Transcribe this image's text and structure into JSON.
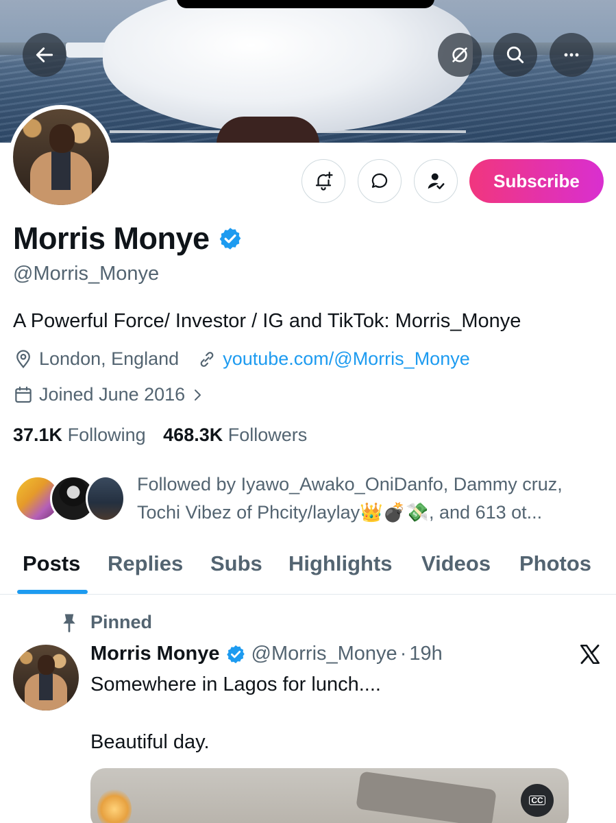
{
  "profile": {
    "name": "Morris Monye",
    "handle": "@Morris_Monye",
    "bio": "A Powerful Force/ Investor / IG and TikTok: Morris_Monye",
    "location": "London, England",
    "website": "youtube.com/@Morris_Monye",
    "joined": "Joined June 2016",
    "verified_color": "#1d9bf0"
  },
  "actions": {
    "subscribe_label": "Subscribe",
    "subscribe_gradient": [
      "#f1367e",
      "#d92fd0"
    ]
  },
  "header_icons": [
    "back-arrow-icon",
    "grok-icon",
    "search-icon",
    "more-icon"
  ],
  "stats": {
    "following_count": "37.1K",
    "following_label": "Following",
    "followers_count": "468.3K",
    "followers_label": "Followers"
  },
  "followed_by": {
    "line1": "Followed by Iyawo_Awako_OniDanfo, Dammy cruz,",
    "line2": "Tochi Vibez of Phcity/laylay👑💣💸, and 613 ot..."
  },
  "tabs": [
    {
      "label": "Posts",
      "active": true
    },
    {
      "label": "Replies",
      "active": false
    },
    {
      "label": "Subs",
      "active": false
    },
    {
      "label": "Highlights",
      "active": false
    },
    {
      "label": "Videos",
      "active": false
    },
    {
      "label": "Photos",
      "active": false
    }
  ],
  "pinned_post": {
    "pinned_label": "Pinned",
    "author": "Morris Monye",
    "handle": "@Morris_Monye",
    "time": "19h",
    "separator": "·",
    "text_line1": "Somewhere in Lagos for lunch....",
    "text_line2": "Beautiful day.",
    "cc_label": "CC"
  },
  "colors": {
    "accent": "#1d9bf0",
    "text_primary": "#0f1419",
    "text_secondary": "#536471"
  }
}
